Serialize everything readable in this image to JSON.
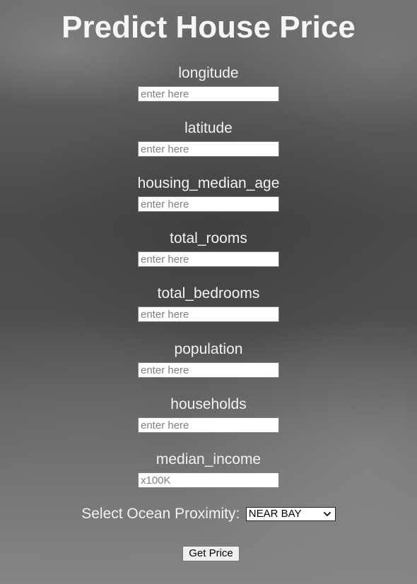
{
  "page": {
    "title": "Predict House Price"
  },
  "form": {
    "fields": [
      {
        "label": "longitude",
        "placeholder": "enter here"
      },
      {
        "label": "latitude",
        "placeholder": "enter here"
      },
      {
        "label": "housing_median_age",
        "placeholder": "enter here"
      },
      {
        "label": "total_rooms",
        "placeholder": "enter here"
      },
      {
        "label": "total_bedrooms",
        "placeholder": "enter here"
      },
      {
        "label": "population",
        "placeholder": "enter here"
      },
      {
        "label": "households",
        "placeholder": "enter here"
      },
      {
        "label": "median_income",
        "placeholder": "x100K"
      }
    ],
    "ocean_proximity": {
      "label": "Select Ocean Proximity:",
      "selected": "NEAR BAY"
    },
    "submit_label": "Get Price"
  }
}
